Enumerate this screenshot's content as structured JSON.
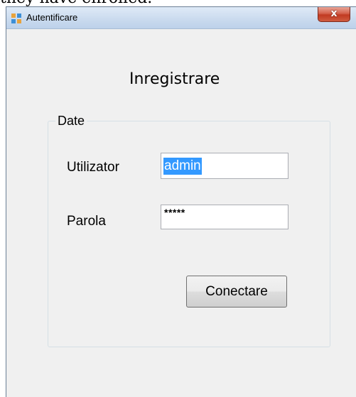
{
  "background_caption": "they have enrolled.",
  "window": {
    "title": "Autentificare",
    "close_glyph": "x"
  },
  "form": {
    "heading": "Inregistrare",
    "group_label": "Date",
    "username_label": "Utilizator",
    "username_value": "admin",
    "password_label": "Parola",
    "password_value": "*****",
    "connect_button": "Conectare"
  },
  "colors": {
    "selection_highlight": "#3399ff",
    "close_button": "#c13a22",
    "window_background": "#f0f0f0"
  },
  "icons": {
    "app_icon": "windows-form-icon",
    "close_icon": "close-icon"
  }
}
